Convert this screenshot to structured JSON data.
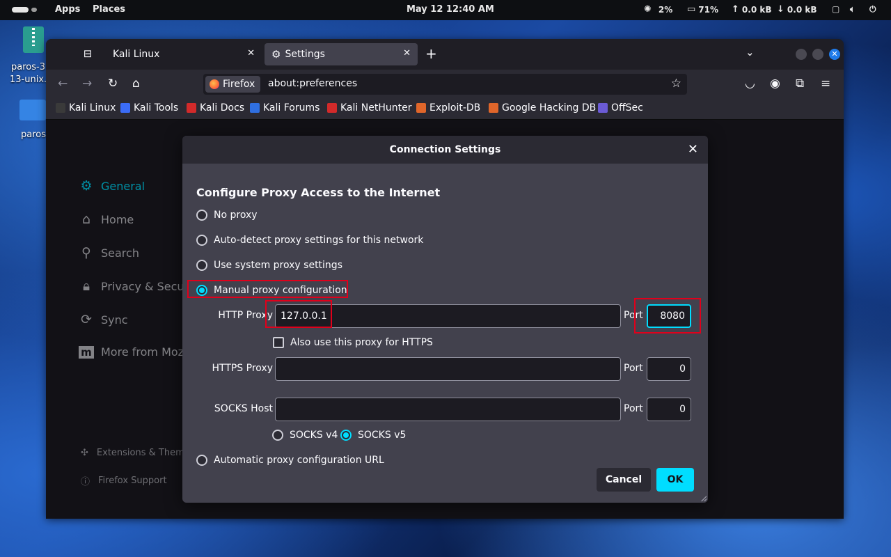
{
  "topbar": {
    "apps": "Apps",
    "places": "Places",
    "clock": "May 12  12:40 AM",
    "cpu": "2%",
    "mem": "71%",
    "up": "0.0 kB",
    "down": "0.0 kB"
  },
  "desktop": {
    "zip_label_1": "paros-3",
    "zip_label_2": "13-unix.",
    "folder_label": "paros"
  },
  "browser": {
    "tabs": [
      {
        "label": "Kali Linux"
      },
      {
        "label": "Settings"
      }
    ],
    "identity_label": "Firefox",
    "url": "about:preferences",
    "bookmarks": [
      {
        "label": "Kali Linux",
        "color": "#3a3a3a"
      },
      {
        "label": "Kali Tools",
        "color": "#3b6cf6"
      },
      {
        "label": "Kali Docs",
        "color": "#d22a2a"
      },
      {
        "label": "Kali Forums",
        "color": "#2f6fe0"
      },
      {
        "label": "Kali NetHunter",
        "color": "#d22a2a"
      },
      {
        "label": "Exploit-DB",
        "color": "#e0662a"
      },
      {
        "label": "Google Hacking DB",
        "color": "#e0662a"
      },
      {
        "label": "OffSec",
        "color": "#6b5bd6"
      }
    ]
  },
  "sidebar": {
    "items": [
      {
        "label": "General",
        "icon": "gear-icon"
      },
      {
        "label": "Home",
        "icon": "home-icon"
      },
      {
        "label": "Search",
        "icon": "search-icon"
      },
      {
        "label": "Privacy & Securit",
        "icon": "lock-icon"
      },
      {
        "label": "Sync",
        "icon": "sync-icon"
      },
      {
        "label": "More from Mozil",
        "icon": "mozilla-icon"
      }
    ],
    "extensions": "Extensions & Theme",
    "support": "Firefox Support"
  },
  "dialog": {
    "title": "Connection Settings",
    "heading": "Configure Proxy Access to the Internet",
    "options": {
      "no_proxy": "No proxy",
      "auto_detect": "Auto-detect proxy settings for this network",
      "system": "Use system proxy settings",
      "manual": "Manual proxy configuration",
      "auto_url": "Automatic proxy configuration URL"
    },
    "selected": "manual",
    "http_label": "HTTP Proxy",
    "http_value": "127.0.0.1",
    "http_port": "8080",
    "port_label": "Port",
    "also_https": "Also use this proxy for HTTPS",
    "also_https_checked": false,
    "https_label": "HTTPS Proxy",
    "https_value": "",
    "https_port": "0",
    "socks_label": "SOCKS Host",
    "socks_value": "",
    "socks_port": "0",
    "socks_v4": "SOCKS v4",
    "socks_v5": "SOCKS v5",
    "socks_selected": "v5",
    "cancel": "Cancel",
    "ok": "OK",
    "highlight_color": "#e0001b",
    "accent": "#00ddff"
  }
}
